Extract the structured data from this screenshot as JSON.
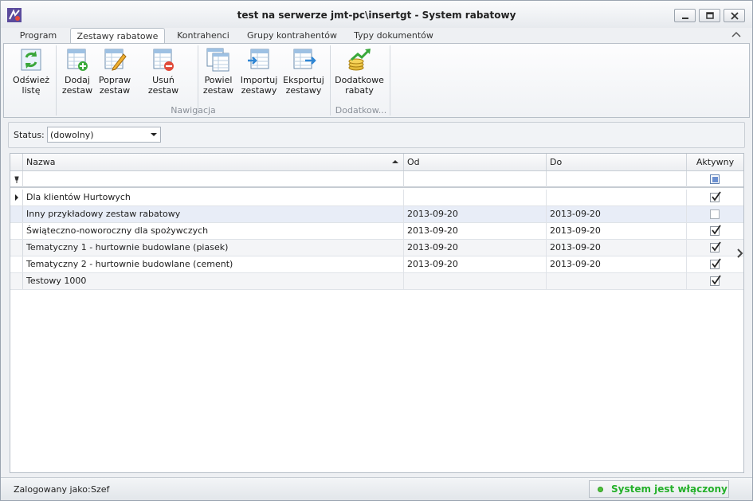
{
  "window": {
    "title": "test na serwerze jmt-pc\\insertgt - System rabatowy"
  },
  "tabs": [
    {
      "label": "Program"
    },
    {
      "label": "Zestawy rabatowe"
    },
    {
      "label": "Kontrahenci"
    },
    {
      "label": "Grupy kontrahentów"
    },
    {
      "label": "Typy dokumentów"
    }
  ],
  "ribbon": {
    "refresh": {
      "line1": "Odśwież",
      "line2": "listę"
    },
    "add": {
      "line1": "Dodaj",
      "line2": "zestaw"
    },
    "edit": {
      "line1": "Popraw",
      "line2": "zestaw"
    },
    "delete": {
      "line1": "Usuń zestaw",
      "line2": ""
    },
    "duplicate": {
      "line1": "Powiel",
      "line2": "zestaw"
    },
    "import": {
      "line1": "Importuj",
      "line2": "zestawy"
    },
    "export": {
      "line1": "Eksportuj",
      "line2": "zestawy"
    },
    "extra": {
      "line1": "Dodatkowe",
      "line2": "rabaty"
    },
    "group_nav": "Nawigacja",
    "group_extra": "Dodatkow..."
  },
  "filter": {
    "status_label": "Status:",
    "status_value": "(dowolny)"
  },
  "grid": {
    "headers": {
      "name": "Nazwa",
      "from": "Od",
      "to": "Do",
      "active": "Aktywny"
    },
    "rows": [
      {
        "name": "Dla klientów Hurtowych",
        "from": "",
        "to": "",
        "active": true
      },
      {
        "name": "Inny przykładowy zestaw rabatowy",
        "from": "2013-09-20",
        "to": "2013-09-20",
        "active": false
      },
      {
        "name": "Świąteczno-noworoczny dla spożywczych",
        "from": "2013-09-20",
        "to": "2013-09-20",
        "active": true
      },
      {
        "name": "Tematyczny 1 - hurtownie budowlane (piasek)",
        "from": "2013-09-20",
        "to": "2013-09-20",
        "active": true
      },
      {
        "name": "Tematyczny 2 - hurtownie budowlane (cement)",
        "from": "2013-09-20",
        "to": "2013-09-20",
        "active": true
      },
      {
        "name": "Testowy 1000",
        "from": "",
        "to": "",
        "active": true
      }
    ]
  },
  "statusbar": {
    "logged_label": "Zalogowany jako:",
    "user": "Szef",
    "system_status": "System jest włączony"
  },
  "colors": {
    "status_green": "#24b02a",
    "selection": "#e8edf7"
  }
}
